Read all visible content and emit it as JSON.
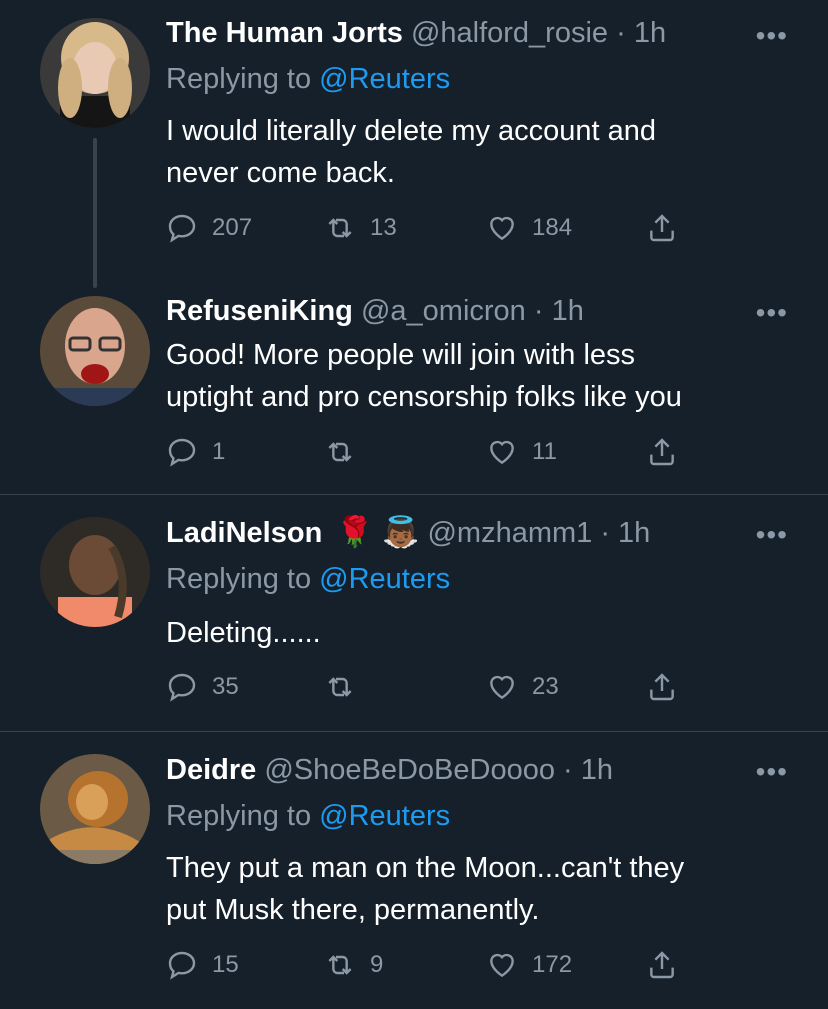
{
  "tweets": [
    {
      "name": "The Human Jorts",
      "handle": "@halford_rosie",
      "time": "· 1h",
      "replying_label": "Replying to",
      "replying_handle": "@Reuters",
      "text_lines": [
        "I would literally delete my account and",
        "never come back."
      ],
      "replies": "207",
      "retweets": "13",
      "likes": "184"
    },
    {
      "name": "RefuseniKing",
      "handle": "@a_omicron",
      "time": "· 1h",
      "text_lines": [
        "Good! More people will join with less",
        "uptight and pro censorship folks like you"
      ],
      "replies": "1",
      "retweets": "",
      "likes": "11"
    },
    {
      "name": "LadiNelson",
      "emoji": "🌹 👼🏾",
      "handle": "@mzhamm1",
      "time": "· 1h",
      "replying_label": "Replying to",
      "replying_handle": "@Reuters",
      "text_lines": [
        "Deleting......"
      ],
      "replies": "35",
      "retweets": "",
      "likes": "23"
    },
    {
      "name": "Deidre",
      "handle": "@ShoeBeDoBeDoooo",
      "time": "· 1h",
      "replying_label": "Replying to",
      "replying_handle": "@Reuters",
      "text_lines": [
        "They put a man on the Moon...can't they",
        "put Musk there, permanently."
      ],
      "replies": "15",
      "retweets": "9",
      "likes": "172"
    }
  ],
  "more_glyph": "•••",
  "icons": {
    "reply": "reply-icon",
    "retweet": "retweet-icon",
    "like": "like-icon",
    "share": "share-icon",
    "more": "more-icon"
  },
  "colors": {
    "background": "#15202b",
    "text": "#ffffff",
    "secondary": "#8b98a5",
    "link": "#1d9bf0",
    "divider": "#38444d"
  }
}
